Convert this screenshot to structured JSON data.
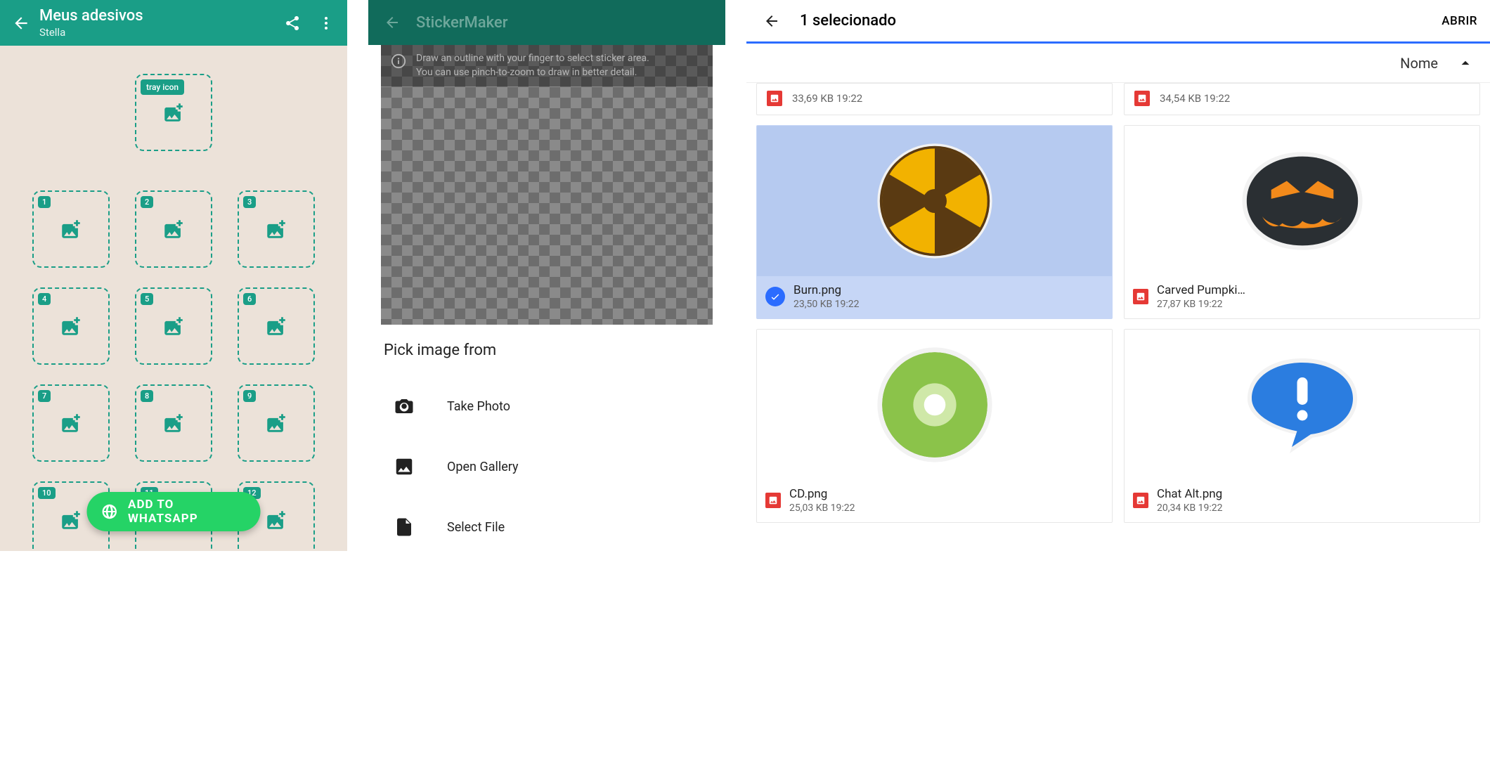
{
  "colors": {
    "teal": "#1a9e87",
    "tealDark": "#116b5b",
    "green": "#25d366",
    "blue": "#2b6cff",
    "red": "#e53935"
  },
  "screen1": {
    "title": "Meus adesivos",
    "subtitle": "Stella",
    "tray_badge": "tray icon",
    "slots": [
      "1",
      "2",
      "3",
      "4",
      "5",
      "6",
      "7",
      "8",
      "9",
      "10",
      "11",
      "12"
    ],
    "fab_label": "ADD TO WHATSAPP"
  },
  "screen2": {
    "title": "StickerMaker",
    "hint_line1": "Draw an outline with your finger to select sticker area.",
    "hint_line2": "You can use pinch-to-zoom to draw in better detail.",
    "pick_title": "Pick image from",
    "options": [
      {
        "icon": "camera",
        "label": "Take Photo"
      },
      {
        "icon": "image",
        "label": "Open Gallery"
      },
      {
        "icon": "file",
        "label": "Select File"
      }
    ]
  },
  "screen3": {
    "title": "1 selecionado",
    "open_label": "ABRIR",
    "sort_label": "Nome",
    "partial_row": [
      {
        "size": "33,69 KB",
        "time": "19:22"
      },
      {
        "size": "34,54 KB",
        "time": "19:22"
      }
    ],
    "files": [
      {
        "name": "Burn.png",
        "size": "23,50 KB",
        "time": "19:22",
        "selected": true,
        "thumb": "burn"
      },
      {
        "name": "Carved Pumpki…",
        "size": "27,87 KB",
        "time": "19:22",
        "selected": false,
        "thumb": "pumpkin"
      },
      {
        "name": "CD.png",
        "size": "25,03 KB",
        "time": "19:22",
        "selected": false,
        "thumb": "cd"
      },
      {
        "name": "Chat Alt.png",
        "size": "20,34 KB",
        "time": "19:22",
        "selected": false,
        "thumb": "chat"
      }
    ]
  }
}
